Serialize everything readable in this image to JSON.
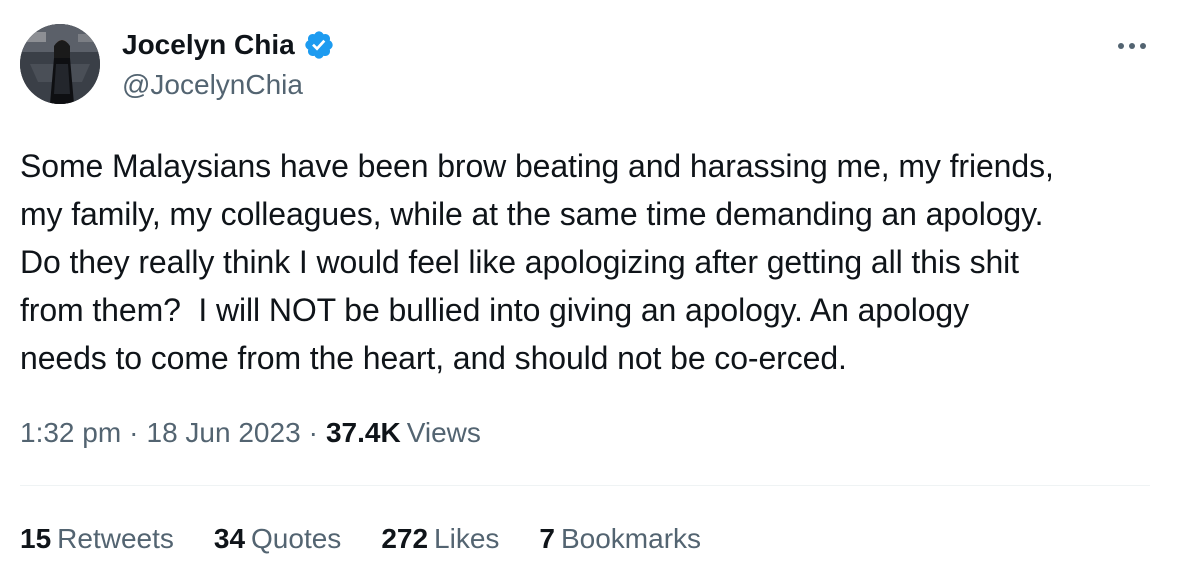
{
  "author": {
    "display_name": "Jocelyn Chia",
    "handle": "@JocelynChia",
    "verified_badge_color": "#1d9bf0"
  },
  "menu": {
    "icon": "more-horizontal-icon"
  },
  "tweet": {
    "text": "Some Malaysians have been brow beating and harassing me, my friends,\nmy family, my colleagues, while at the same time demanding an apology.\nDo they really think I would feel like apologizing after getting all this shit\nfrom them?  I will NOT be bullied into giving an apology. An apology\nneeds to come from the heart, and should not be co-erced."
  },
  "meta": {
    "time": "1:32 pm",
    "separator": "·",
    "date": "18 Jun 2023",
    "views_count": "37.4K",
    "views_label": "Views"
  },
  "stats": [
    {
      "count": "15",
      "label": "Retweets"
    },
    {
      "count": "34",
      "label": "Quotes"
    },
    {
      "count": "272",
      "label": "Likes"
    },
    {
      "count": "7",
      "label": "Bookmarks"
    }
  ],
  "colors": {
    "text_primary": "#0f1419",
    "text_secondary": "#536471",
    "divider": "#eff3f4",
    "accent": "#1d9bf0"
  }
}
